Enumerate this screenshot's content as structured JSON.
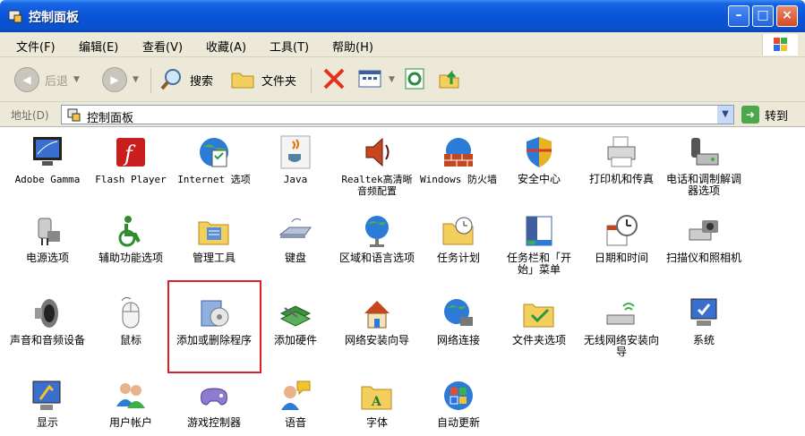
{
  "window": {
    "title": "控制面板"
  },
  "menu": [
    "文件(F)",
    "编辑(E)",
    "查看(V)",
    "收藏(A)",
    "工具(T)",
    "帮助(H)"
  ],
  "toolbar": {
    "back": "后退",
    "search": "搜索",
    "folders": "文件夹"
  },
  "address": {
    "label": "地址(D)",
    "value": "控制面板",
    "go": "转到"
  },
  "items": [
    [
      "Adobe Gamma",
      "Flash Player",
      "Internet 选项",
      "Java",
      "Realtek高清晰音频配置",
      "Windows 防火墙",
      "安全中心",
      "打印机和传真",
      "电话和调制解调器选项"
    ],
    [
      "电源选项",
      "辅助功能选项",
      "管理工具",
      "键盘",
      "区域和语言选项",
      "任务计划",
      "任务栏和「开始」菜单",
      "日期和时间",
      "扫描仪和照相机"
    ],
    [
      "声音和音频设备",
      "鼠标",
      "添加或删除程序",
      "添加硬件",
      "网络安装向导",
      "网络连接",
      "文件夹选项",
      "无线网络安装向导",
      "系统"
    ],
    [
      "显示",
      "用户帐户",
      "游戏控制器",
      "语音",
      "字体",
      "自动更新"
    ]
  ],
  "colors": {
    "title_blue": "#0a54d8",
    "highlight": "#e02020"
  }
}
